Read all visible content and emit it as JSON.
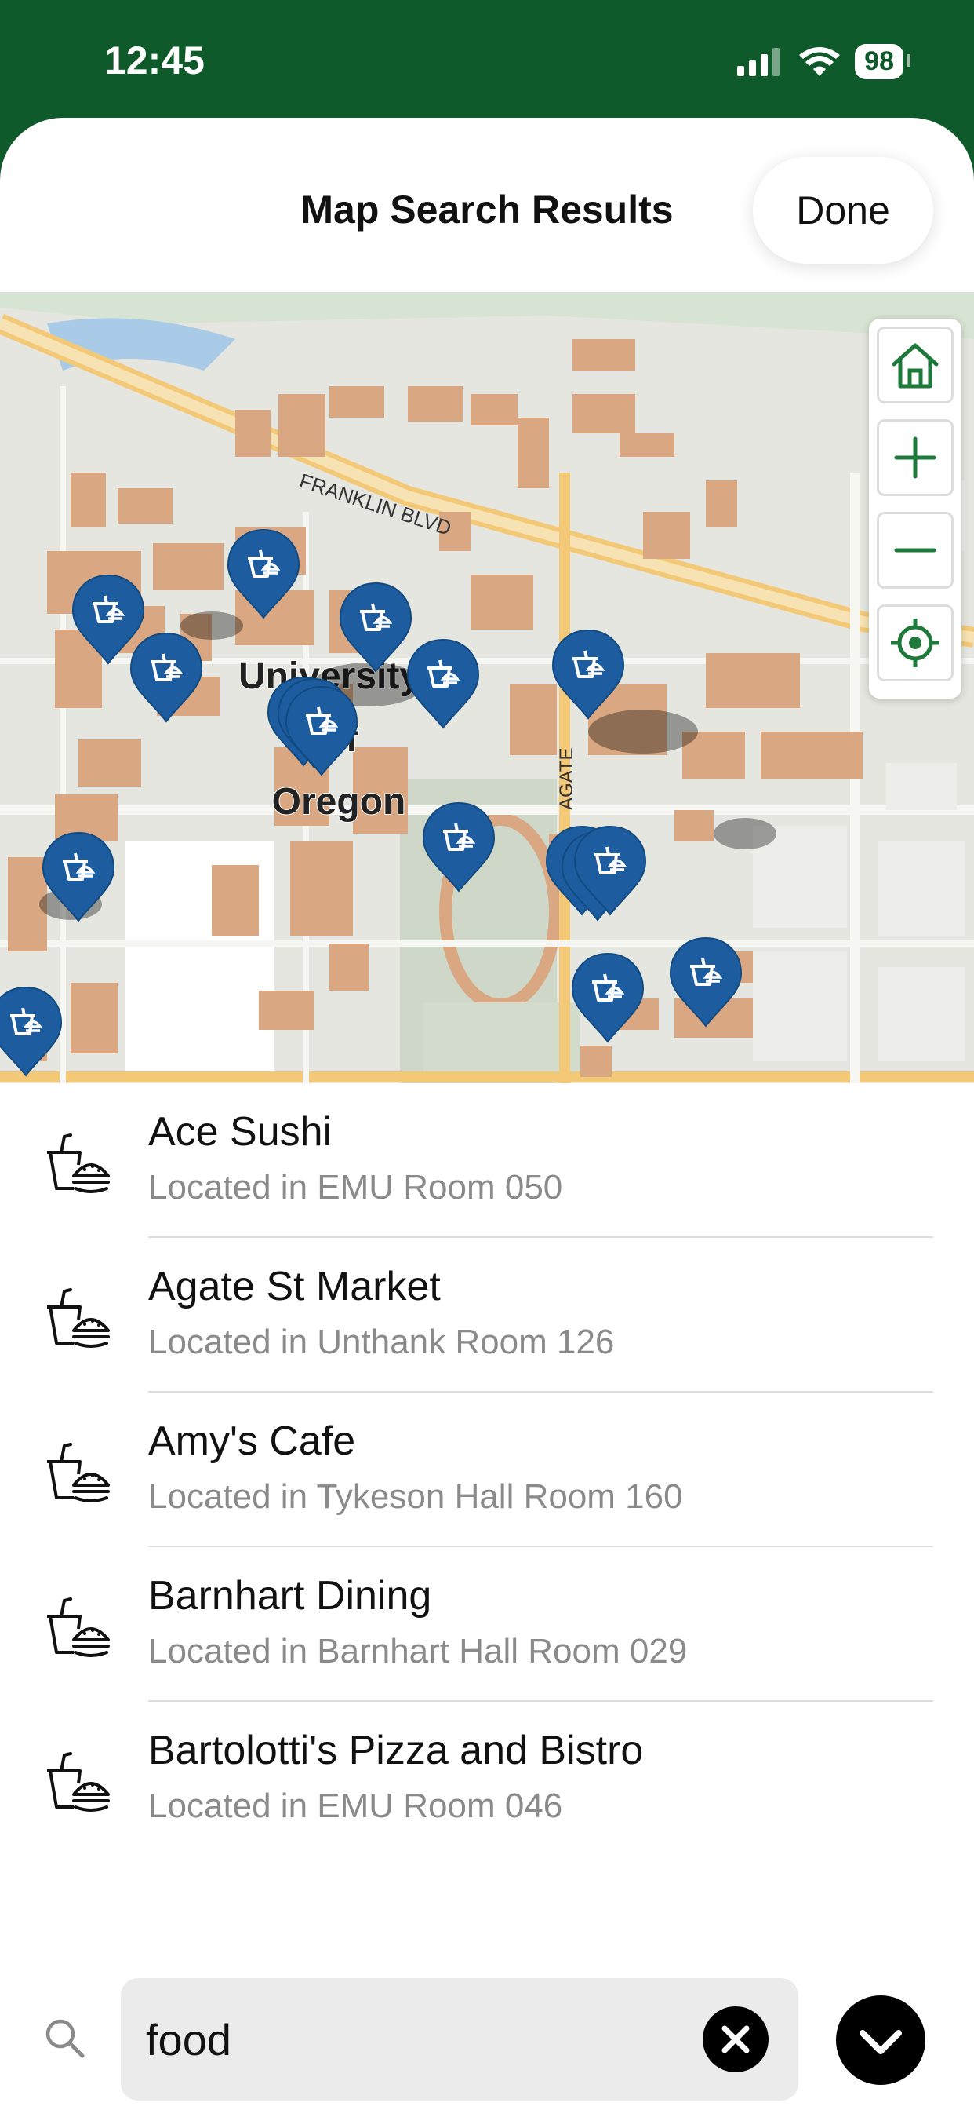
{
  "status_bar": {
    "time": "12:45",
    "battery": "98"
  },
  "header": {
    "title": "Map Search Results",
    "done_label": "Done"
  },
  "map": {
    "campus_label_1": "University",
    "campus_label_2": "of",
    "campus_label_3": "Oregon",
    "street_label_1": "FRANKLIN BLVD",
    "street_label_2": "AGATE",
    "controls": [
      "home-icon",
      "zoom-in-icon",
      "zoom-out-icon",
      "locate-icon"
    ]
  },
  "results": [
    {
      "name": "Ace Sushi",
      "location": "Located in EMU Room 050"
    },
    {
      "name": "Agate St Market",
      "location": "Located in Unthank Room 126"
    },
    {
      "name": "Amy's Cafe",
      "location": "Located in Tykeson Hall Room 160"
    },
    {
      "name": "Barnhart Dining",
      "location": "Located in Barnhart Hall Room 029"
    },
    {
      "name": "Bartolotti's Pizza and Bistro",
      "location": "Located in EMU Room 046"
    }
  ],
  "search": {
    "value": "food"
  },
  "colors": {
    "brand_green": "#0f5a2a",
    "pin_blue": "#1d5c9e",
    "building": "#d9a882"
  }
}
